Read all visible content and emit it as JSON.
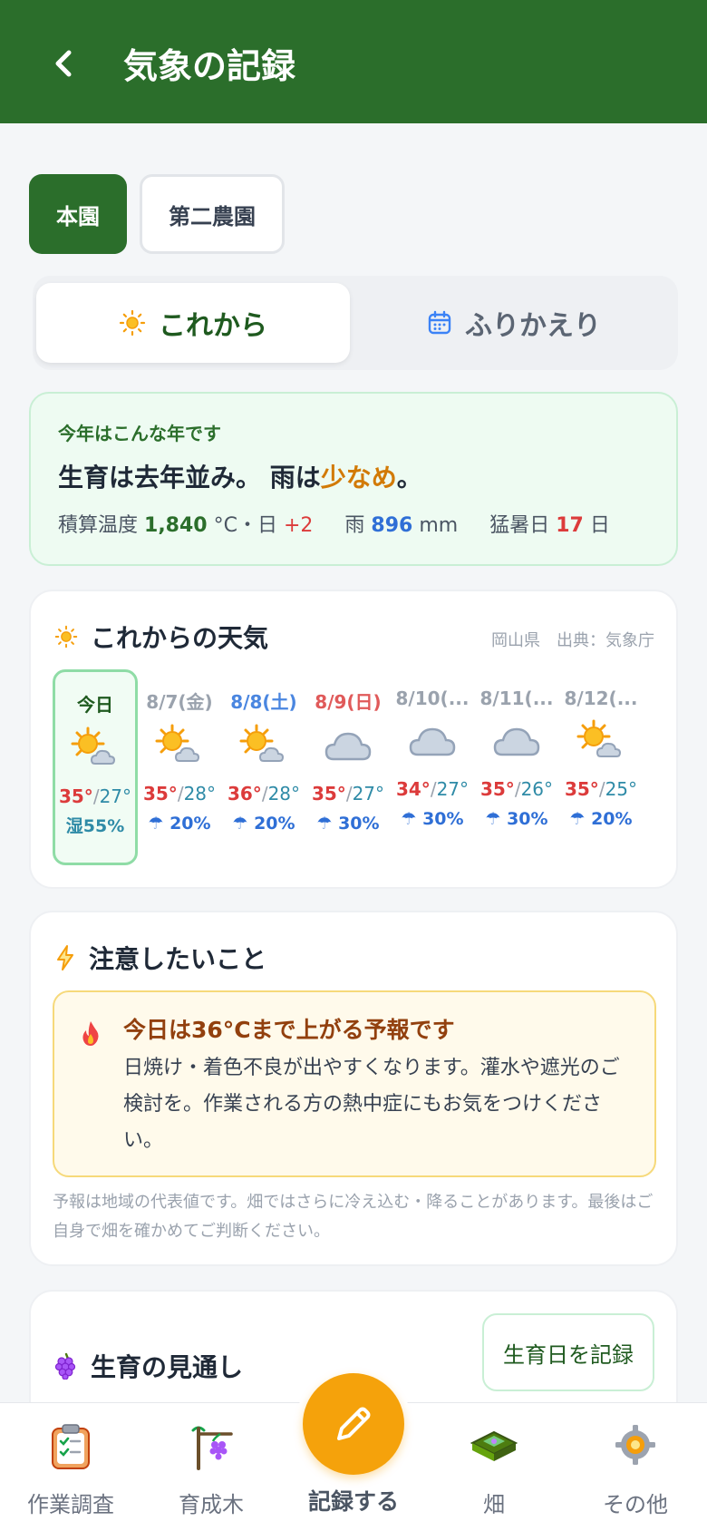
{
  "header": {
    "back_icon": "chevron-left-icon",
    "title": "気象の記録"
  },
  "farm_tabs": [
    {
      "label": "本園",
      "active": true
    },
    {
      "label": "第二農園",
      "active": false
    }
  ],
  "mode_tabs": [
    {
      "label": "これから",
      "icon": "sun-icon",
      "active": true
    },
    {
      "label": "ふりかえり",
      "icon": "calendar-icon",
      "active": false
    }
  ],
  "summary": {
    "label": "今年はこんな年です",
    "headline_pre": "生育は去年並み。 雨は",
    "headline_highlight": "少なめ",
    "headline_post": "。",
    "gdd_label": "積算温度",
    "gdd_value": "1,840",
    "gdd_unit": "°C・日",
    "gdd_diff": "+2",
    "rain_label": "雨",
    "rain_value": "896",
    "rain_unit": "mm",
    "hot_label": "猛暑日",
    "hot_value": "17",
    "hot_unit": "日"
  },
  "weather": {
    "title": "これからの天気",
    "source": "岡山県　出典：気象庁",
    "days": [
      {
        "date": "今日",
        "icon": "sun-cloud-icon",
        "high": "35°",
        "low": "27°",
        "humidity": "湿55%",
        "today": true
      },
      {
        "date": "8/7(金)",
        "icon": "sun-cloud-icon",
        "high": "35°",
        "low": "28°",
        "rain": "20%",
        "date_color": "#9aa2ad"
      },
      {
        "date": "8/8(土)",
        "icon": "sun-cloud-icon",
        "high": "36°",
        "low": "28°",
        "rain": "20%",
        "date_color": "#4a86e0"
      },
      {
        "date": "8/9(日)",
        "icon": "cloud-icon",
        "high": "35°",
        "low": "27°",
        "rain": "30%",
        "date_color": "#e05a5a"
      },
      {
        "date": "8/10(...",
        "icon": "cloud-icon",
        "high": "34°",
        "low": "27°",
        "rain": "30%",
        "date_color": "#9aa2ad"
      },
      {
        "date": "8/11(...",
        "icon": "cloud-icon",
        "high": "35°",
        "low": "26°",
        "rain": "30%",
        "date_color": "#9aa2ad"
      },
      {
        "date": "8/12(...",
        "icon": "sun-cloud-icon",
        "high": "35°",
        "low": "25°",
        "rain": "20%",
        "date_color": "#9aa2ad"
      }
    ]
  },
  "caution": {
    "title": "注意したいこと",
    "alert_title": "今日は36°Cまで上がる予報です",
    "alert_body": "日焼け・着色不良が出やすくなります。灌水や遮光のご検討を。作業される方の熱中症にもお気をつけください。",
    "note": "予報は地域の代表値です。畑ではさらに冷え込む・降ることがあります。最後はご自身で畑を確かめてご判断ください。"
  },
  "growth": {
    "title": "生育の見通し",
    "button": "生育日を記録"
  },
  "nav": {
    "items": [
      {
        "label": "作業調査",
        "icon": "clipboard-icon"
      },
      {
        "label": "育成木",
        "icon": "grape-trellis-icon"
      },
      {
        "label": "記録する",
        "icon": "pencil-icon"
      },
      {
        "label": "畑",
        "icon": "field-icon"
      },
      {
        "label": "その他",
        "icon": "gear-icon"
      }
    ]
  },
  "colors": {
    "brand": "#2b6e2b",
    "accent": "#f5a20b",
    "hot": "#dc3b3b",
    "rain": "#2f6fd6"
  }
}
